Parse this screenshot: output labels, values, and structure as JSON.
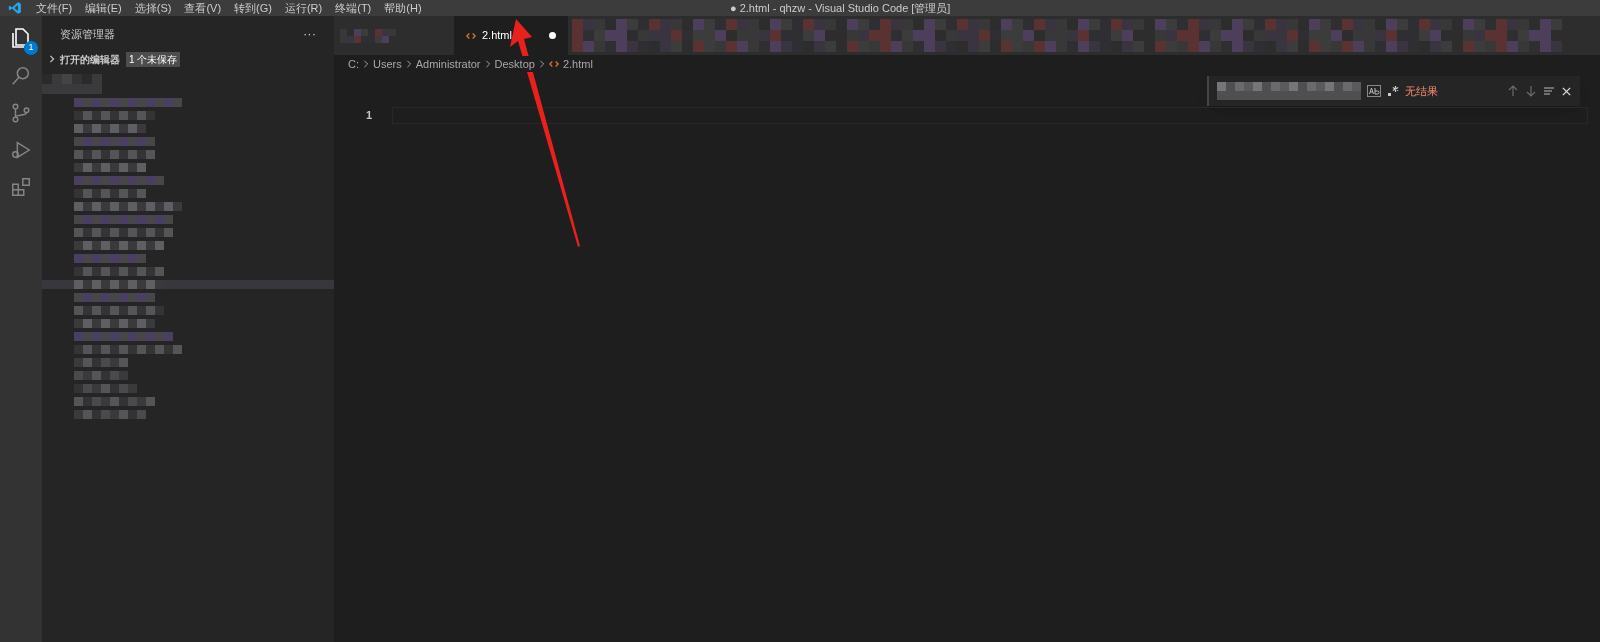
{
  "menu": [
    "文件(F)",
    "编辑(E)",
    "选择(S)",
    "查看(V)",
    "转到(G)",
    "运行(R)",
    "终端(T)",
    "帮助(H)"
  ],
  "window": {
    "title": "● 2.html - qhzw - Visual Studio Code [管理员]"
  },
  "activity_bar": {
    "explorer_badge": "1"
  },
  "sidebar": {
    "title": "资源管理器",
    "more": "···",
    "section": {
      "label": "打开的编辑器",
      "expanded": false,
      "badge": "1 个未保存"
    }
  },
  "tabs": [
    {
      "label": "2.html",
      "selected": true,
      "dirty": true
    }
  ],
  "breadcrumb": [
    "C:",
    "Users",
    "Administrator",
    "Desktop",
    "2.html"
  ],
  "find_widget": {
    "status": "无结果"
  },
  "editor": {
    "line_numbers": [
      "1"
    ]
  }
}
